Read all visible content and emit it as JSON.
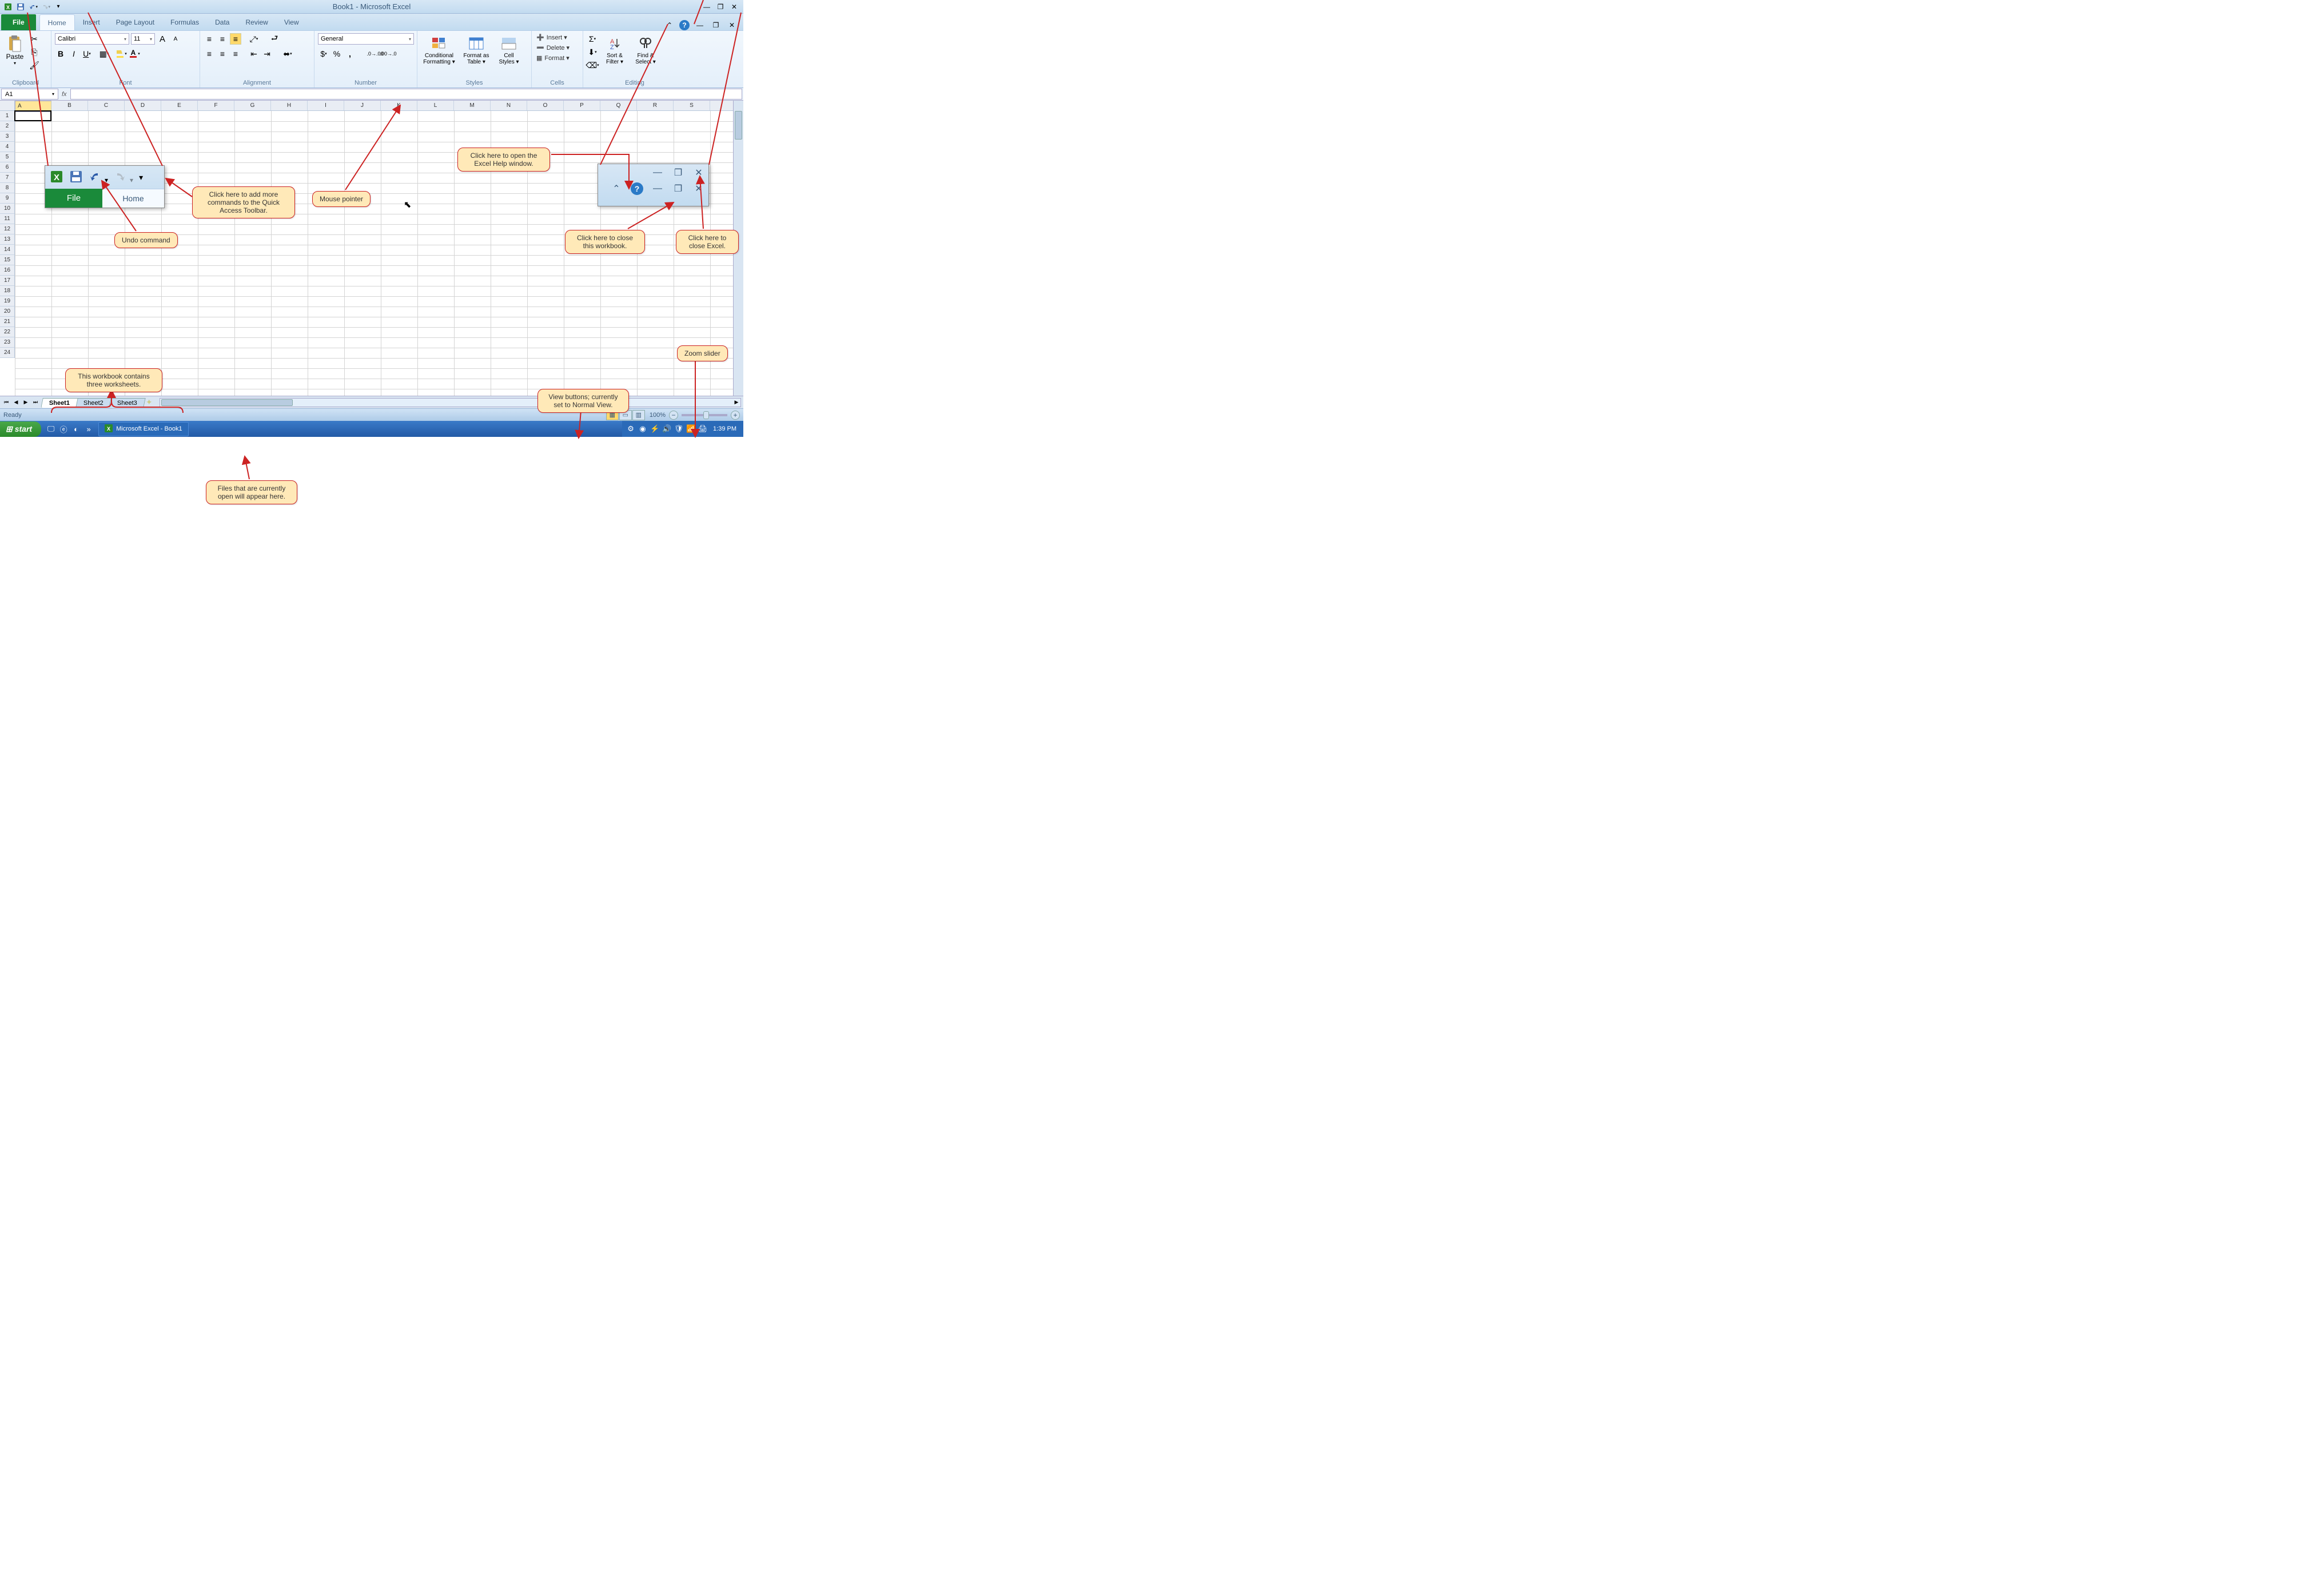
{
  "title": "Book1 - Microsoft Excel",
  "tabs": {
    "file": "File",
    "home": "Home",
    "insert": "Insert",
    "page_layout": "Page Layout",
    "formulas": "Formulas",
    "data": "Data",
    "review": "Review",
    "view": "View"
  },
  "ribbon": {
    "clipboard": {
      "paste": "Paste",
      "label": "Clipboard"
    },
    "font": {
      "name": "Calibri",
      "size": "11",
      "label": "Font"
    },
    "alignment": {
      "label": "Alignment"
    },
    "number": {
      "format": "General",
      "label": "Number"
    },
    "styles": {
      "cond": "Conditional Formatting ▾",
      "table": "Format as Table ▾",
      "cell": "Cell Styles ▾",
      "label": "Styles"
    },
    "cells": {
      "insert": "Insert ▾",
      "delete": "Delete ▾",
      "format": "Format ▾",
      "label": "Cells"
    },
    "editing": {
      "sort": "Sort & Filter ▾",
      "find": "Find & Select ▾",
      "label": "Editing"
    }
  },
  "namebox": "A1",
  "columns": [
    "A",
    "B",
    "C",
    "D",
    "E",
    "F",
    "G",
    "H",
    "I",
    "J",
    "K",
    "L",
    "M",
    "N",
    "O",
    "P",
    "Q",
    "R",
    "S"
  ],
  "rows": [
    "1",
    "2",
    "3",
    "4",
    "5",
    "6",
    "7",
    "8",
    "9",
    "10",
    "11",
    "12",
    "13",
    "14",
    "15",
    "16",
    "17",
    "18",
    "19",
    "20",
    "21",
    "22",
    "23",
    "24"
  ],
  "sheets": [
    "Sheet1",
    "Sheet2",
    "Sheet3"
  ],
  "status": {
    "ready": "Ready",
    "zoom": "100%"
  },
  "taskbar": {
    "start": "start",
    "task": "Microsoft Excel - Book1",
    "time": "1:39 PM"
  },
  "callouts": {
    "qat": "Click here to add more commands to the Quick Access Toolbar.",
    "undo": "Undo command",
    "mouse": "Mouse pointer",
    "help": "Click here to open the Excel Help window.",
    "closewb": "Click here to close this workbook.",
    "closeex": "Click here to close Excel.",
    "zoom": "Zoom slider",
    "views": "View buttons; currently set to Normal View.",
    "sheets": "This workbook contains three worksheets.",
    "files": "Files that are currently open will appear here."
  },
  "inset_tabs": {
    "file": "File",
    "home": "Home"
  }
}
